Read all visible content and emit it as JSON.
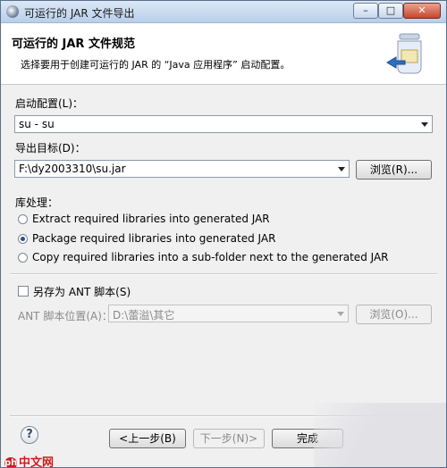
{
  "window": {
    "title": "可运行的 JAR 文件导出",
    "minimize": "–",
    "maximize": "□",
    "close": "✕"
  },
  "header": {
    "title": "可运行的 JAR 文件规范",
    "description": "选择要用于创建可运行的 JAR 的 “Java 应用程序” 启动配置。"
  },
  "launch_config": {
    "label": "启动配置(L)：",
    "value": "su - su"
  },
  "export_target": {
    "label": "导出目标(D)：",
    "value": "F:\\dy2003310\\su.jar",
    "browse_label": "浏览(R)..."
  },
  "library_handling": {
    "label": "库处理：",
    "options": [
      {
        "label": "Extract required libraries into generated JAR",
        "selected": false
      },
      {
        "label": "Package required libraries into generated JAR",
        "selected": true
      },
      {
        "label": "Copy required libraries into a sub-folder next to the generated JAR",
        "selected": false
      }
    ]
  },
  "ant": {
    "checkbox_label": "另存为 ANT 脚本(S)",
    "checked": false,
    "location_label": "ANT 脚本位置(A)：",
    "location_value": "D:\\蕾溢\\其它",
    "browse_label": "浏览(O)..."
  },
  "footer": {
    "help_label": "?",
    "back_label": "<上一步(B)",
    "next_label": "下一步(N)>",
    "finish_label": "完成"
  },
  "watermark": {
    "icon_text": "php",
    "text": "中文网"
  }
}
